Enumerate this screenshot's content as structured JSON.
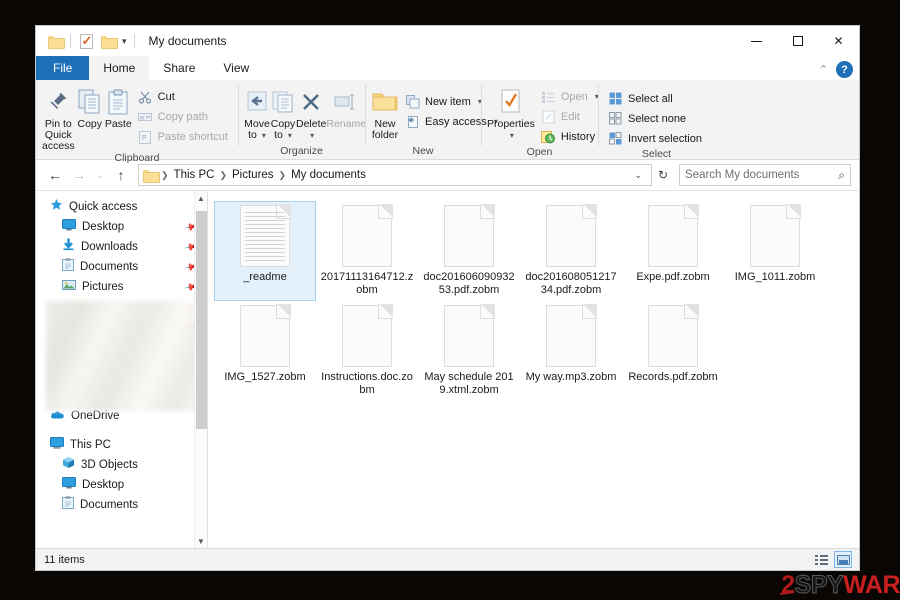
{
  "window": {
    "title": "My documents",
    "quick_access": [
      {
        "name": "folder-icon",
        "label": "Folder"
      },
      {
        "name": "properties-icon",
        "label": "Properties"
      },
      {
        "name": "new-folder-icon",
        "label": "New folder"
      },
      {
        "name": "chevron-down-icon",
        "label": "Customize Quick Access Toolbar"
      }
    ],
    "controls": {
      "minimize": "Minimize",
      "maximize": "Maximize",
      "close": "Close",
      "collapse_ribbon": "Collapse the Ribbon",
      "help": "?"
    }
  },
  "tabs": [
    {
      "label": "File",
      "kind": "file"
    },
    {
      "label": "Home",
      "kind": "active"
    },
    {
      "label": "Share",
      "kind": "normal"
    },
    {
      "label": "View",
      "kind": "normal"
    }
  ],
  "ribbon": {
    "groups": [
      {
        "label": "Clipboard",
        "big_buttons": [
          {
            "label": "Pin to Quick\naccess",
            "icon": "pin-icon",
            "line1": "Pin to Quick",
            "line2": "access"
          },
          {
            "label": "Copy",
            "icon": "copy-icon",
            "line1": "Copy",
            "line2": ""
          },
          {
            "label": "Paste",
            "icon": "paste-icon",
            "line1": "Paste",
            "line2": ""
          }
        ],
        "small_buttons": [
          {
            "label": "Cut",
            "icon": "scissors-icon",
            "disabled": false
          },
          {
            "label": "Copy path",
            "icon": "copy-path-icon",
            "disabled": true
          },
          {
            "label": "Paste shortcut",
            "icon": "paste-shortcut-icon",
            "disabled": true
          }
        ]
      },
      {
        "label": "Organize",
        "big_buttons": [
          {
            "line1": "Move",
            "line2": "to",
            "icon": "move-to-icon",
            "caret": true,
            "disabled": false
          },
          {
            "line1": "Copy",
            "line2": "to",
            "icon": "copy-to-icon",
            "caret": true,
            "disabled": false
          },
          {
            "line1": "Delete",
            "line2": "",
            "icon": "delete-icon",
            "caret": true,
            "disabled": false
          },
          {
            "line1": "Rename",
            "line2": "",
            "icon": "rename-icon",
            "caret": false,
            "disabled": true
          }
        ],
        "small_buttons": []
      },
      {
        "label": "New",
        "big_buttons": [
          {
            "line1": "New",
            "line2": "folder",
            "icon": "new-folder-icon",
            "caret": false,
            "disabled": false
          }
        ],
        "small_buttons": [
          {
            "label": "New item",
            "icon": "new-item-icon",
            "caret": true,
            "disabled": false
          },
          {
            "label": "Easy access",
            "icon": "easy-access-icon",
            "caret": true,
            "disabled": false
          }
        ]
      },
      {
        "label": "Open",
        "big_buttons": [
          {
            "line1": "Properties",
            "line2": "",
            "icon": "properties-icon",
            "caret": true,
            "disabled": false
          }
        ],
        "small_buttons": [
          {
            "label": "Open",
            "icon": "open-icon",
            "caret": true,
            "disabled": true
          },
          {
            "label": "Edit",
            "icon": "edit-icon",
            "caret": false,
            "disabled": true
          },
          {
            "label": "History",
            "icon": "history-icon",
            "caret": false,
            "disabled": false
          }
        ]
      },
      {
        "label": "Select",
        "big_buttons": [],
        "small_buttons": [
          {
            "label": "Select all",
            "icon": "select-all-icon",
            "caret": false,
            "disabled": false
          },
          {
            "label": "Select none",
            "icon": "select-none-icon",
            "caret": false,
            "disabled": false
          },
          {
            "label": "Invert selection",
            "icon": "invert-selection-icon",
            "caret": false,
            "disabled": false
          }
        ]
      }
    ]
  },
  "address": {
    "back": "←",
    "forward": "→",
    "recent": "⌄",
    "up": "↑",
    "breadcrumbs": [
      "This PC",
      "Pictures",
      "My documents"
    ],
    "dropdown": "⌄",
    "refresh": "↻"
  },
  "search": {
    "placeholder": "Search My documents",
    "value": ""
  },
  "sidebar": {
    "groups": [
      {
        "header": {
          "label": "Quick access",
          "icon": "star-icon"
        },
        "items": [
          {
            "label": "Desktop",
            "icon": "desktop-icon",
            "pinned": true
          },
          {
            "label": "Downloads",
            "icon": "downloads-icon",
            "pinned": true
          },
          {
            "label": "Documents",
            "icon": "documents-icon",
            "pinned": true
          },
          {
            "label": "Pictures",
            "icon": "pictures-icon",
            "pinned": true
          },
          {
            "label": "",
            "icon": "blurred-icon",
            "pinned": true,
            "blurred": true
          },
          {
            "label": "",
            "icon": "blurred-icon",
            "pinned": true,
            "blurred": true
          },
          {
            "label": "",
            "icon": "blurred-icon",
            "pinned": false,
            "blurred": true
          },
          {
            "label": "",
            "icon": "blurred-icon",
            "pinned": false,
            "blurred": true
          }
        ]
      },
      {
        "header": {
          "label": "OneDrive",
          "icon": "onedrive-icon"
        },
        "items": []
      },
      {
        "header": {
          "label": "This PC",
          "icon": "thispc-icon"
        },
        "items": [
          {
            "label": "3D Objects",
            "icon": "3dobjects-icon",
            "pinned": false
          },
          {
            "label": "Desktop",
            "icon": "desktop-icon",
            "pinned": false
          },
          {
            "label": "Documents",
            "icon": "documents-icon",
            "pinned": false
          }
        ]
      }
    ]
  },
  "files": [
    {
      "name": "_readme",
      "icon": "text-document-icon",
      "selected": true
    },
    {
      "name": "20171113164712.zobm",
      "icon": "blank-document-icon",
      "selected": false
    },
    {
      "name": "doc20160609093253.pdf.zobm",
      "icon": "blank-document-icon",
      "selected": false
    },
    {
      "name": "doc20160805121734.pdf.zobm",
      "icon": "blank-document-icon",
      "selected": false
    },
    {
      "name": "Expe.pdf.zobm",
      "icon": "blank-document-icon",
      "selected": false
    },
    {
      "name": "IMG_1011.zobm",
      "icon": "blank-document-icon",
      "selected": false
    },
    {
      "name": "IMG_1527.zobm",
      "icon": "blank-document-icon",
      "selected": false
    },
    {
      "name": "Instructions.doc.zobm",
      "icon": "blank-document-icon",
      "selected": false
    },
    {
      "name": "May schedule 2019.xtml.zobm",
      "icon": "blank-document-icon",
      "selected": false
    },
    {
      "name": "My way.mp3.zobm",
      "icon": "blank-document-icon",
      "selected": false
    },
    {
      "name": "Records.pdf.zobm",
      "icon": "blank-document-icon",
      "selected": false
    }
  ],
  "status": {
    "item_count": "11 items",
    "views": [
      {
        "name": "details-view",
        "label": "Display the items by using details view",
        "active": false
      },
      {
        "name": "large-icons-view",
        "label": "Display the items by using large thumbnails",
        "active": true
      }
    ]
  },
  "watermark": {
    "part1": "2",
    "part2": "SPY",
    "part3": "WAR"
  },
  "colors": {
    "accent": "#1d6fb8",
    "selection_bg": "#e4f1fb",
    "selection_border": "#a7cfee",
    "ribbon_bg": "#f3f3f3",
    "watermark_red": "#c81f1f"
  }
}
